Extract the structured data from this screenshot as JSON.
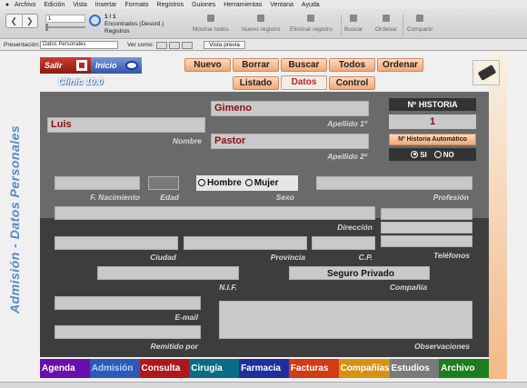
{
  "menubar": {
    "items": [
      "Archivo",
      "Edición",
      "Vista",
      "Insertar",
      "Formato",
      "Registros",
      "Guiones",
      "Herramientas",
      "Ventana",
      "Ayuda"
    ]
  },
  "toolbar": {
    "record_value": "1",
    "record_count": "1 / 1",
    "found_label": "Encontrados (Desord.)",
    "records_label": "Registros",
    "show_all": "Mostrar todos",
    "new_record": "Nuevo registro",
    "delete_record": "Eliminar registro",
    "search": "Buscar",
    "sort": "Ordenar",
    "share": "Compartir"
  },
  "layoutbar": {
    "presentation_label": "Presentación:",
    "presentation_value": "Datos Personales",
    "view_as_label": "Ver como:",
    "preview_label": "Vista previa"
  },
  "app": {
    "title": "Admisión - Datos Personales",
    "salir": "Salir",
    "inicio": "Inicio",
    "clinic_name": "Clinic 10.0",
    "actions": {
      "nuevo": "Nuevo",
      "borrar": "Borrar",
      "buscar": "Buscar",
      "todos": "Todos",
      "ordenar": "Ordenar"
    },
    "tabs": {
      "listado": "Listado",
      "datos": "Datos",
      "control": "Control"
    }
  },
  "patient": {
    "nombre": "Luis",
    "apellido1": "Gimeno",
    "apellido2": "Pastor",
    "edad": "",
    "seguro": "Seguro Privado"
  },
  "labels": {
    "nombre": "Nombre",
    "apellido1": "Apellido 1º",
    "apellido2": "Apellido 2º",
    "f_nacimiento": "F. Nacimiento",
    "edad": "Edad",
    "sexo": "Sexo",
    "hombre": "Hombre",
    "mujer": "Mujer",
    "profesion": "Profesión",
    "direccion": "Dirección",
    "ciudad": "Ciudad",
    "provincia": "Provincia",
    "cp": "C.P.",
    "telefonos": "Teléfonos",
    "nif": "N.I.F.",
    "compania": "Compañía",
    "email": "E-mail",
    "remitido": "Remitido por",
    "observaciones": "Observaciones"
  },
  "historia": {
    "title": "Nº HISTORIA",
    "number": "1",
    "auto_label": "Nº Historia Automático",
    "si": "SI",
    "no": "NO"
  },
  "bottom_nav": [
    {
      "label": "Agenda",
      "color": "#6a0dad"
    },
    {
      "label": "Admisión",
      "color": "#2c59b8",
      "text": "#b9d3ff"
    },
    {
      "label": "Consulta",
      "color": "#b0161d"
    },
    {
      "label": "Cirugía",
      "color": "#0b6b86"
    },
    {
      "label": "Farmacia",
      "color": "#1d2f9e"
    },
    {
      "label": "Facturas",
      "color": "#d43a13"
    },
    {
      "label": "Compañías",
      "color": "#d79010"
    },
    {
      "label": "Estudios",
      "color": "#7a7a7a"
    },
    {
      "label": "Archivo",
      "color": "#1b7d1b"
    }
  ]
}
